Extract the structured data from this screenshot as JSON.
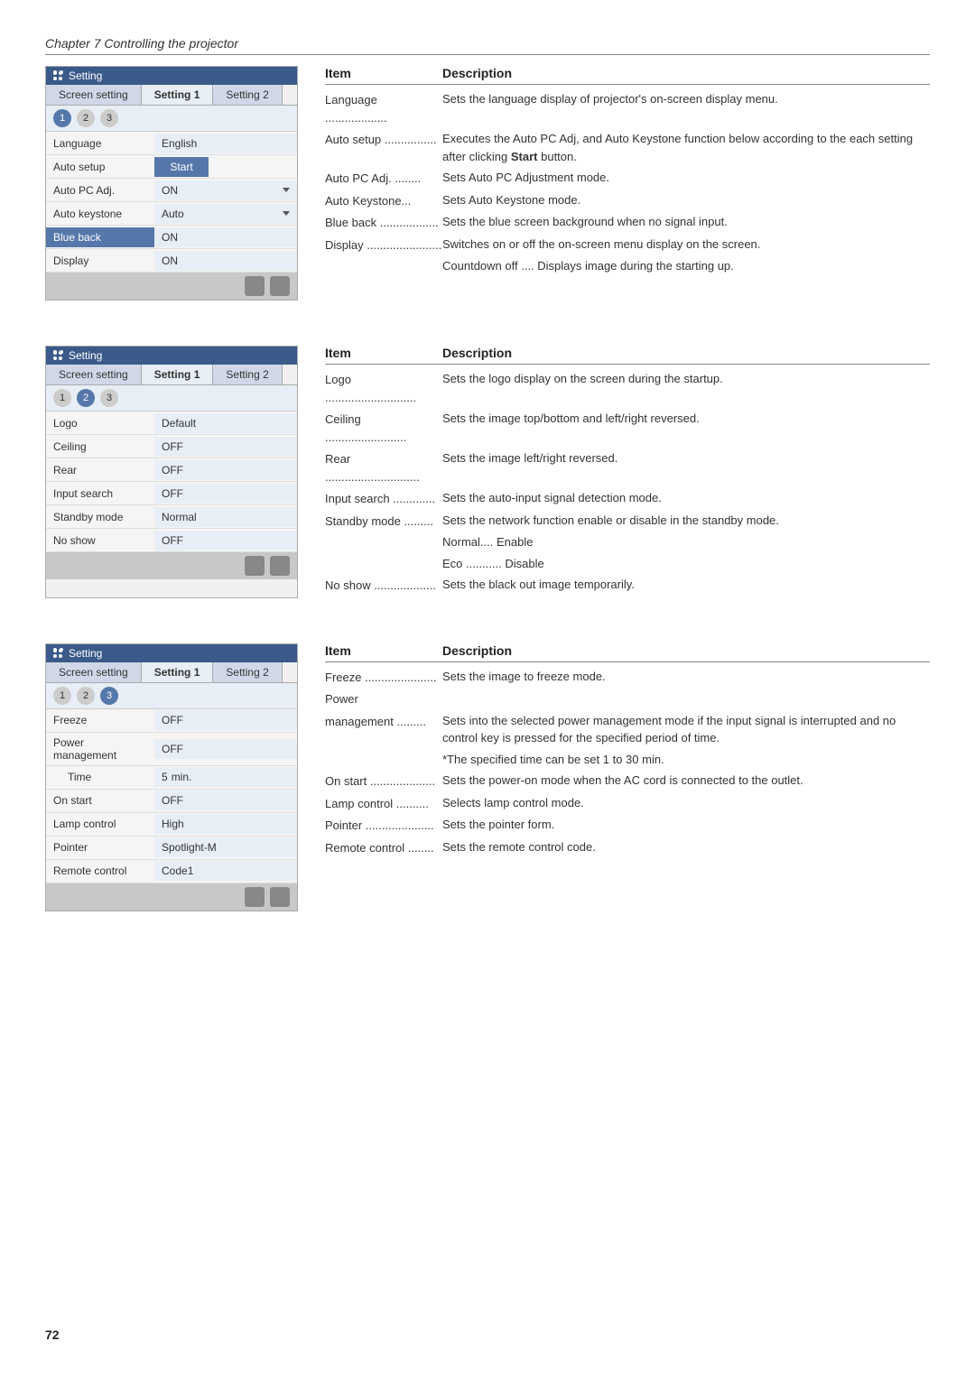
{
  "chapter": "Chapter 7 Controlling the projector",
  "page_number": "72",
  "section1": {
    "panel": {
      "title": "Setting",
      "tabs": [
        "Screen setting",
        "Setting 1",
        "Setting 2"
      ],
      "active_tab": "Setting 1",
      "tab_numbers": [
        "1",
        "2",
        "3"
      ],
      "active_num": 1,
      "rows": [
        {
          "label": "Language",
          "value": "English",
          "has_arrow": false,
          "highlight": false
        },
        {
          "label": "Auto setup",
          "value": "Start",
          "is_btn": true,
          "highlight": false
        },
        {
          "label": "Auto PC Adj.",
          "value": "ON",
          "has_arrow": true,
          "highlight": false
        },
        {
          "label": "Auto keystone",
          "value": "Auto",
          "has_arrow": true,
          "highlight": false
        },
        {
          "label": "Blue back",
          "value": "ON",
          "has_arrow": false,
          "highlight": true
        },
        {
          "label": "Display",
          "value": "ON",
          "has_arrow": false,
          "highlight": false
        }
      ]
    },
    "table": {
      "col_item": "Item",
      "col_desc": "Description",
      "rows": [
        {
          "item": "Language ...................",
          "desc": "Sets the language display of projector's on-screen display menu."
        },
        {
          "item": "Auto setup ................",
          "desc": "Executes the Auto PC Adj, and Auto Keystone function below according to the each setting after clicking Start button."
        },
        {
          "item": "  Auto PC Adj. ........",
          "desc": "Sets Auto PC Adjustment mode."
        },
        {
          "item": "  Auto Keystone...",
          "desc": "Sets Auto Keystone mode."
        },
        {
          "item": "Blue back ..................",
          "desc": "Sets the blue screen background  when no signal input."
        },
        {
          "item": "Display .......................",
          "desc": "Switches on or off the on-screen menu display on the screen."
        },
        {
          "item": "",
          "desc": "Countdown off .... Displays image during the starting up."
        }
      ]
    }
  },
  "section2": {
    "panel": {
      "title": "Setting",
      "tabs": [
        "Screen setting",
        "Setting 1",
        "Setting 2"
      ],
      "active_tab": "Setting 1",
      "tab_numbers": [
        "1",
        "2",
        "3"
      ],
      "active_num": 2,
      "rows": [
        {
          "label": "Logo",
          "value": "Default",
          "has_arrow": false,
          "highlight": false
        },
        {
          "label": "Ceiling",
          "value": "OFF",
          "has_arrow": false,
          "highlight": false
        },
        {
          "label": "Rear",
          "value": "OFF",
          "has_arrow": false,
          "highlight": false
        },
        {
          "label": "Input search",
          "value": "OFF",
          "has_arrow": false,
          "highlight": false
        },
        {
          "label": "Standby mode",
          "value": "Normal",
          "has_arrow": false,
          "highlight": false
        },
        {
          "label": "No show",
          "value": "OFF",
          "has_arrow": false,
          "highlight": false
        }
      ]
    },
    "table": {
      "col_item": "Item",
      "col_desc": "Description",
      "rows": [
        {
          "item": "Logo ............................",
          "desc": "Sets the logo display on the screen during the startup."
        },
        {
          "item": "Ceiling .........................",
          "desc": "Sets the image top/bottom and left/right reversed."
        },
        {
          "item": "Rear .............................",
          "desc": "Sets the image left/right reversed."
        },
        {
          "item": "Input search .............",
          "desc": "Sets the auto-input signal detection mode."
        },
        {
          "item": "Standby mode .........",
          "desc": "Sets the network function enable or disable in the standby mode."
        },
        {
          "item": "",
          "desc": "Normal.... Enable"
        },
        {
          "item": "",
          "desc": "Eco ........... Disable"
        },
        {
          "item": "No show ...................",
          "desc": "Sets the black out image temporarily."
        }
      ]
    }
  },
  "section3": {
    "panel": {
      "title": "Setting",
      "tabs": [
        "Screen setting",
        "Setting 1",
        "Setting 2"
      ],
      "active_tab": "Setting 1",
      "tab_numbers": [
        "1",
        "2",
        "3"
      ],
      "active_num": 3,
      "rows": [
        {
          "label": "Freeze",
          "value": "OFF",
          "has_arrow": false,
          "highlight": false
        },
        {
          "label": "Power management",
          "value": "OFF",
          "has_arrow": false,
          "highlight": false
        },
        {
          "label": "Time",
          "value": "5",
          "suffix": "min.",
          "has_arrow": false,
          "highlight": false
        },
        {
          "label": "On start",
          "value": "OFF",
          "has_arrow": false,
          "highlight": false
        },
        {
          "label": "Lamp control",
          "value": "High",
          "has_arrow": false,
          "highlight": false
        },
        {
          "label": "Pointer",
          "value": "Spotlight-M",
          "has_arrow": false,
          "highlight": false
        },
        {
          "label": "Remote control",
          "value": "Code1",
          "has_arrow": false,
          "highlight": false
        }
      ]
    },
    "table": {
      "col_item": "Item",
      "col_desc": "Description",
      "rows": [
        {
          "item": "Freeze ......................",
          "desc": "Sets the image to freeze mode."
        },
        {
          "item": "Power",
          "desc": ""
        },
        {
          "item": "management .........",
          "desc": "Sets into the selected power management mode if the input signal is interrupted and no control key is pressed for the specified period of time."
        },
        {
          "item": "",
          "desc": "*The specified time can be set 1 to 30 min."
        },
        {
          "item": "On start ....................",
          "desc": "Sets the power-on mode when the AC cord  is connected to the outlet."
        },
        {
          "item": "Lamp control ..........",
          "desc": "Selects lamp control mode."
        },
        {
          "item": "Pointer .....................",
          "desc": "Sets the pointer form."
        },
        {
          "item": "Remote control ........",
          "desc": "Sets the remote control code."
        }
      ]
    }
  }
}
